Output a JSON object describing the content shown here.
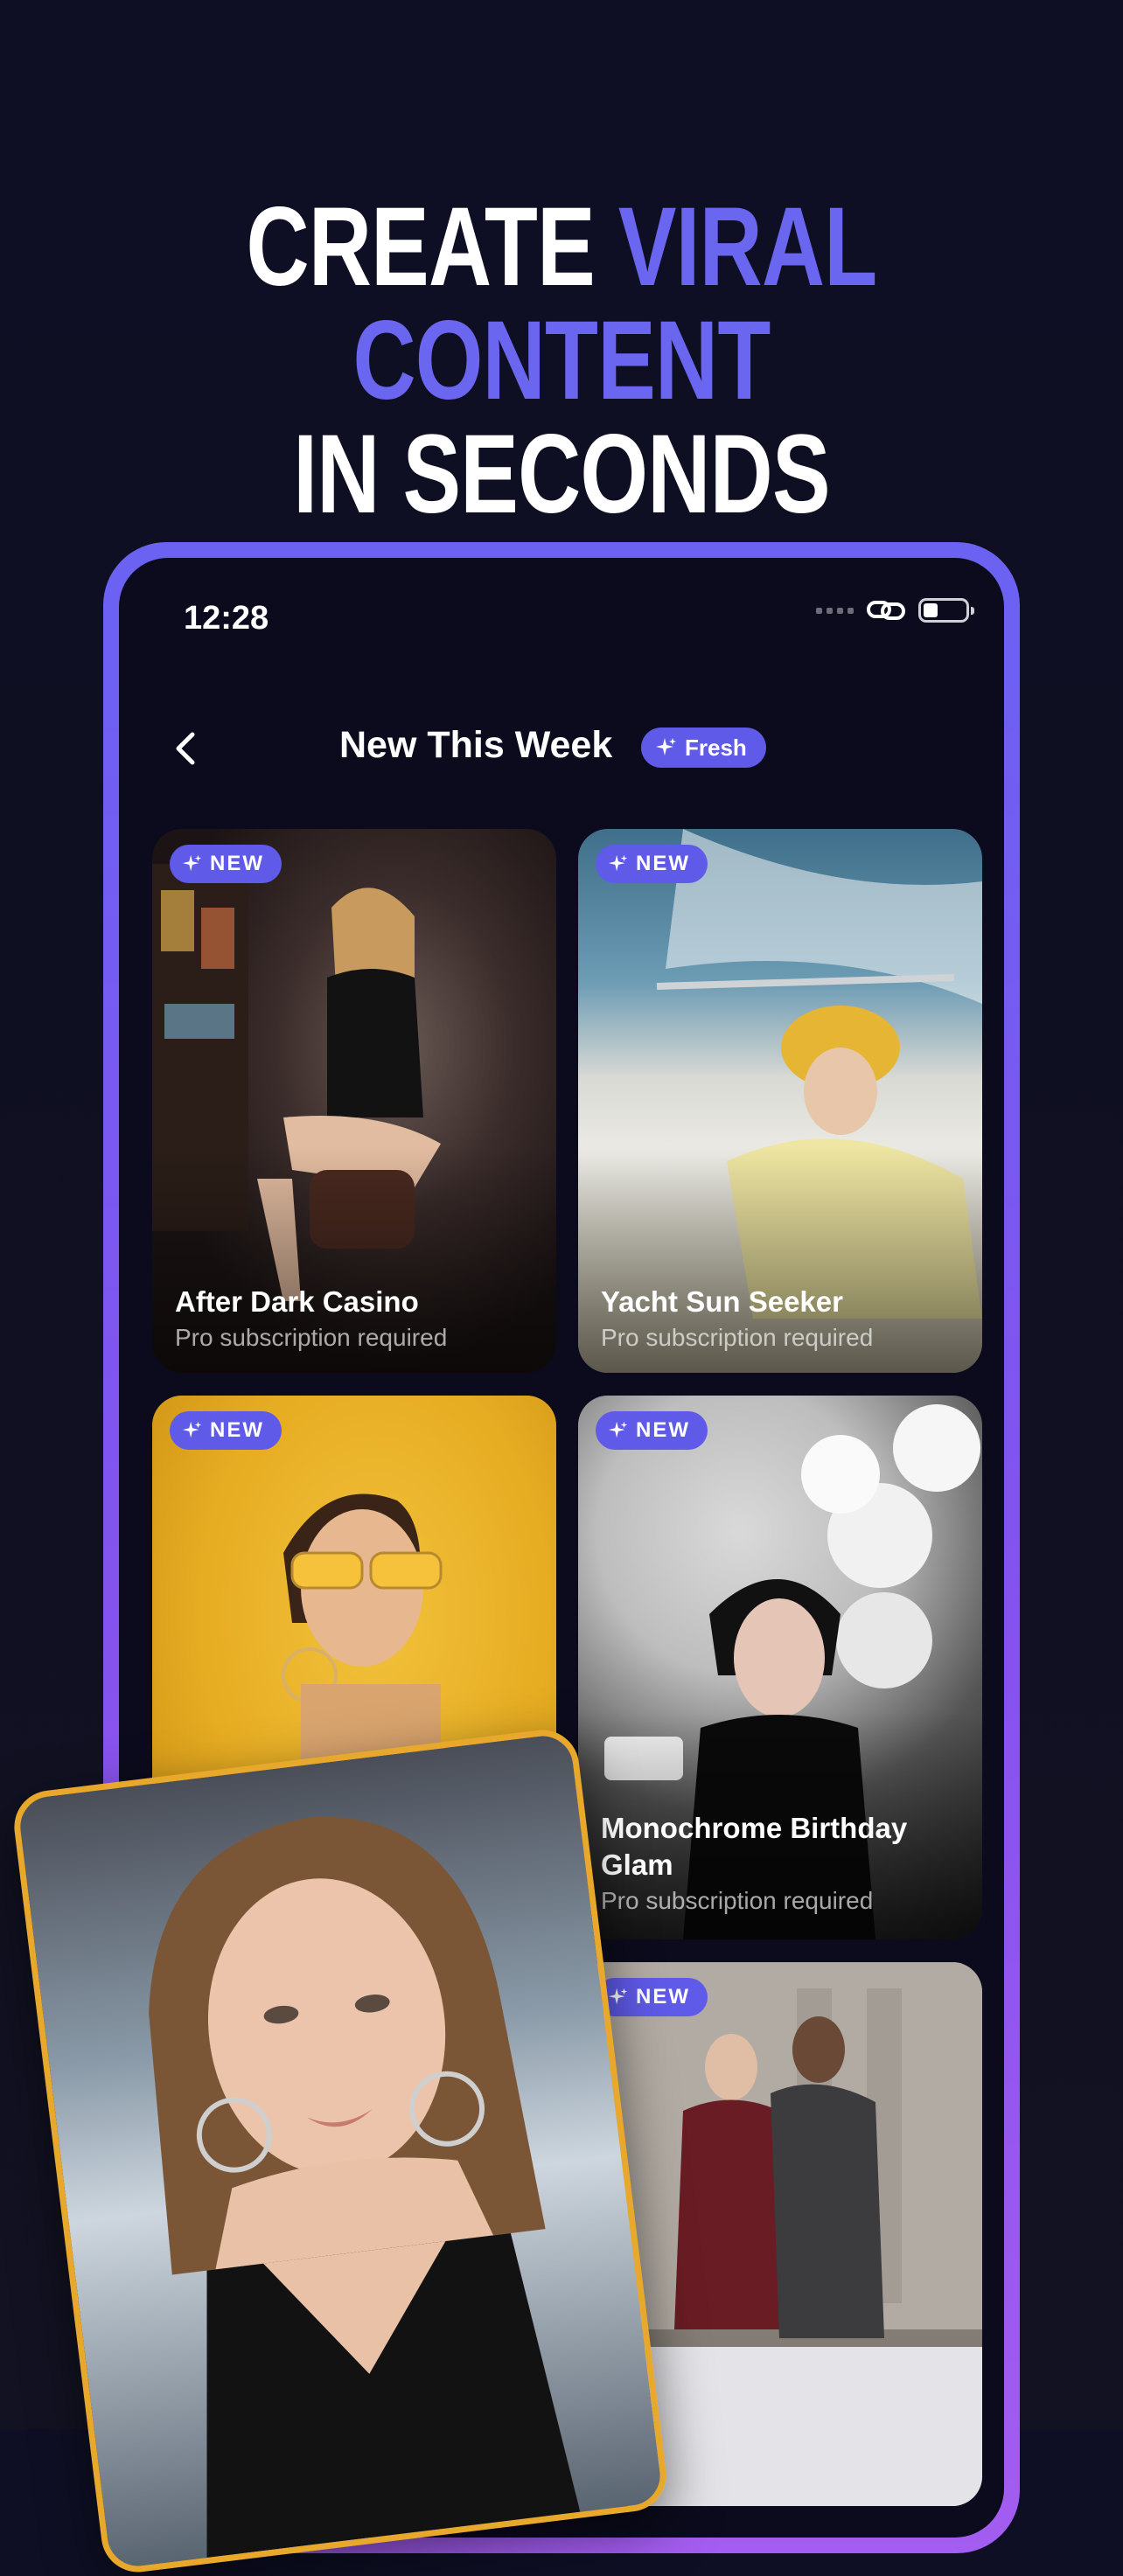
{
  "headline": {
    "line1_white": "CREATE",
    "line1_accent": "VIRAL CONTENT",
    "line2": "IN SECONDS"
  },
  "status_bar": {
    "time": "12:28"
  },
  "nav": {
    "title": "New This Week",
    "badge": "Fresh"
  },
  "cards": [
    {
      "badge": "NEW",
      "title": "After Dark Casino",
      "subtitle": "Pro subscription required"
    },
    {
      "badge": "NEW",
      "title": "Yacht Sun Seeker",
      "subtitle": "Pro subscription required"
    },
    {
      "badge": "NEW",
      "title": "",
      "subtitle": ""
    },
    {
      "badge": "NEW",
      "title": "Monochrome Birthday Glam",
      "subtitle": "Pro subscription required"
    },
    {
      "badge": "NEW",
      "title": "",
      "subtitle": ""
    }
  ],
  "colors": {
    "accent": "#6a66f0",
    "badge": "#5f5ae8",
    "frame_gold": "#e7a82b"
  },
  "icons": [
    "back-chevron-icon",
    "sparkle-icon",
    "link-icon",
    "battery-icon",
    "signal-icon"
  ]
}
